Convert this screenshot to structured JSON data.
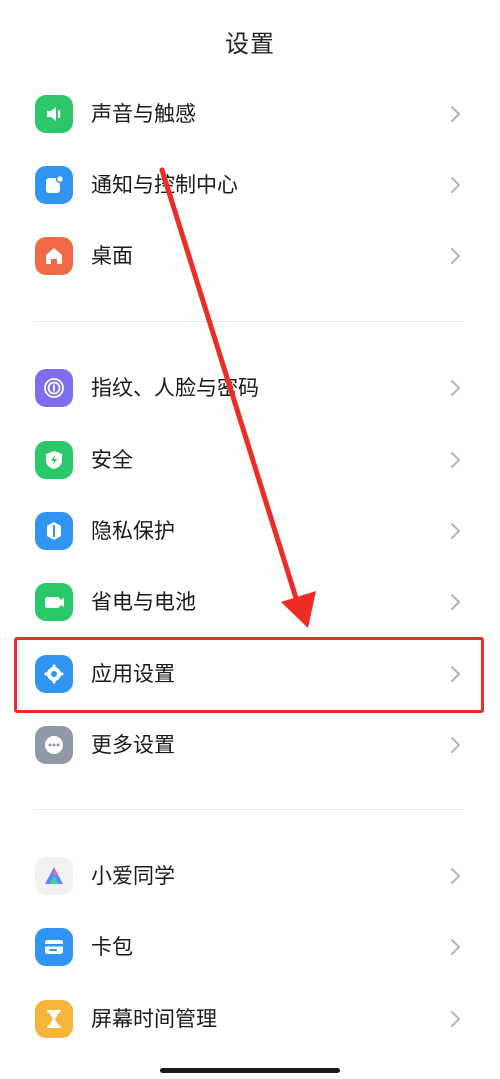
{
  "header": {
    "title": "设置"
  },
  "items": [
    {
      "id": "sound",
      "label": "声音与触感",
      "icon": "speaker-icon",
      "color": "#2dc76a"
    },
    {
      "id": "notify",
      "label": "通知与控制中心",
      "icon": "notification-icon",
      "color": "#2f95f0"
    },
    {
      "id": "desktop",
      "label": "桌面",
      "icon": "home-icon",
      "color": "#f06a46"
    },
    {
      "id": "fingerprint",
      "label": "指纹、人脸与密码",
      "icon": "fingerprint-icon",
      "color": "#7d6ef0"
    },
    {
      "id": "security",
      "label": "安全",
      "icon": "shield-bolt-icon",
      "color": "#2bc86a"
    },
    {
      "id": "privacy",
      "label": "隐私保护",
      "icon": "privacy-icon",
      "color": "#2f95f0"
    },
    {
      "id": "battery",
      "label": "省电与电池",
      "icon": "battery-icon",
      "color": "#2bc86a"
    },
    {
      "id": "apps",
      "label": "应用设置",
      "icon": "gear-icon",
      "color": "#2f95f0"
    },
    {
      "id": "more",
      "label": "更多设置",
      "icon": "more-dots-icon",
      "color": "#8f9aa6"
    },
    {
      "id": "xiaoai",
      "label": "小爱同学",
      "icon": "xiaoai-icon",
      "color": "#f2f2f2"
    },
    {
      "id": "wallet",
      "label": "卡包",
      "icon": "wallet-icon",
      "color": "#2f95f0"
    },
    {
      "id": "screentime",
      "label": "屏幕时间管理",
      "icon": "hourglass-icon",
      "color": "#f6b43a"
    }
  ],
  "annotation": {
    "highlight_color": "#ee2b24",
    "highlighted_item": "应用设置"
  }
}
